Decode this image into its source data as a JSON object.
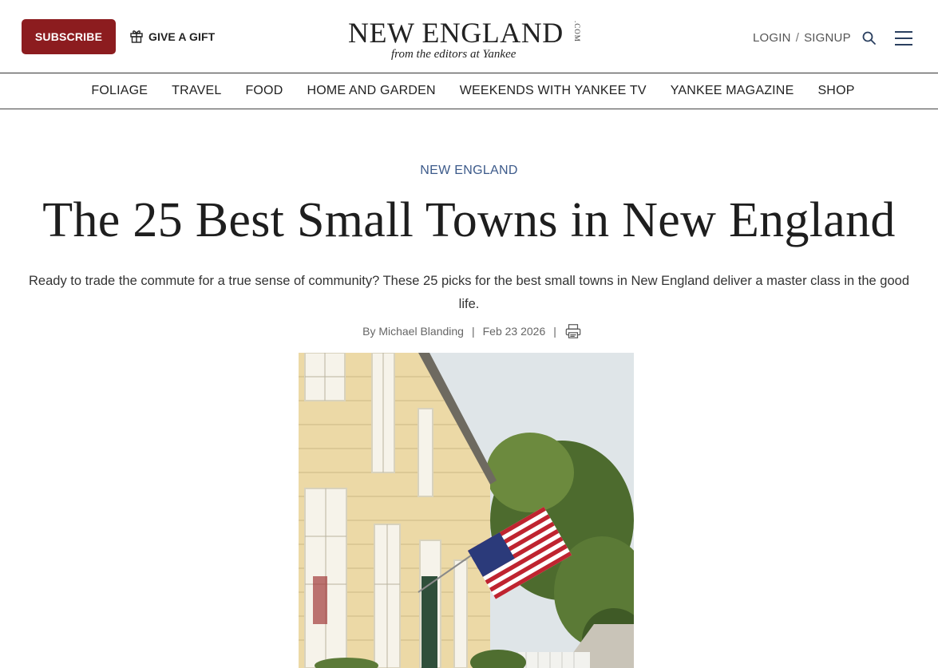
{
  "header": {
    "subscribe_label": "SUBSCRIBE",
    "gift_label": "GIVE A GIFT",
    "logo_main": "NEW ENGLAND",
    "logo_com": ".COM",
    "logo_sub": "from the editors at Yankee",
    "login_label": "LOGIN",
    "signup_label": "SIGNUP",
    "auth_separator": "/"
  },
  "nav": {
    "items": [
      {
        "label": "FOLIAGE"
      },
      {
        "label": "TRAVEL"
      },
      {
        "label": "FOOD"
      },
      {
        "label": "HOME AND GARDEN"
      },
      {
        "label": "WEEKENDS WITH YANKEE TV"
      },
      {
        "label": "YANKEE MAGAZINE"
      },
      {
        "label": "SHOP"
      }
    ]
  },
  "article": {
    "category": "NEW ENGLAND",
    "title": "The 25 Best Small Towns in New England",
    "dek": "Ready to trade the commute for a true sense of community? These 25 picks for the best small towns in New England deliver a master class in the good life.",
    "author": "By Michael Blanding",
    "date": "Feb 23 2026",
    "separator": "|"
  },
  "colors": {
    "subscribe_bg": "#8c1c1f",
    "category_link": "#3c5a8a"
  },
  "icons": {
    "gift": "gift-icon",
    "search": "search-icon",
    "menu": "hamburger-menu-icon",
    "print": "print-icon"
  }
}
